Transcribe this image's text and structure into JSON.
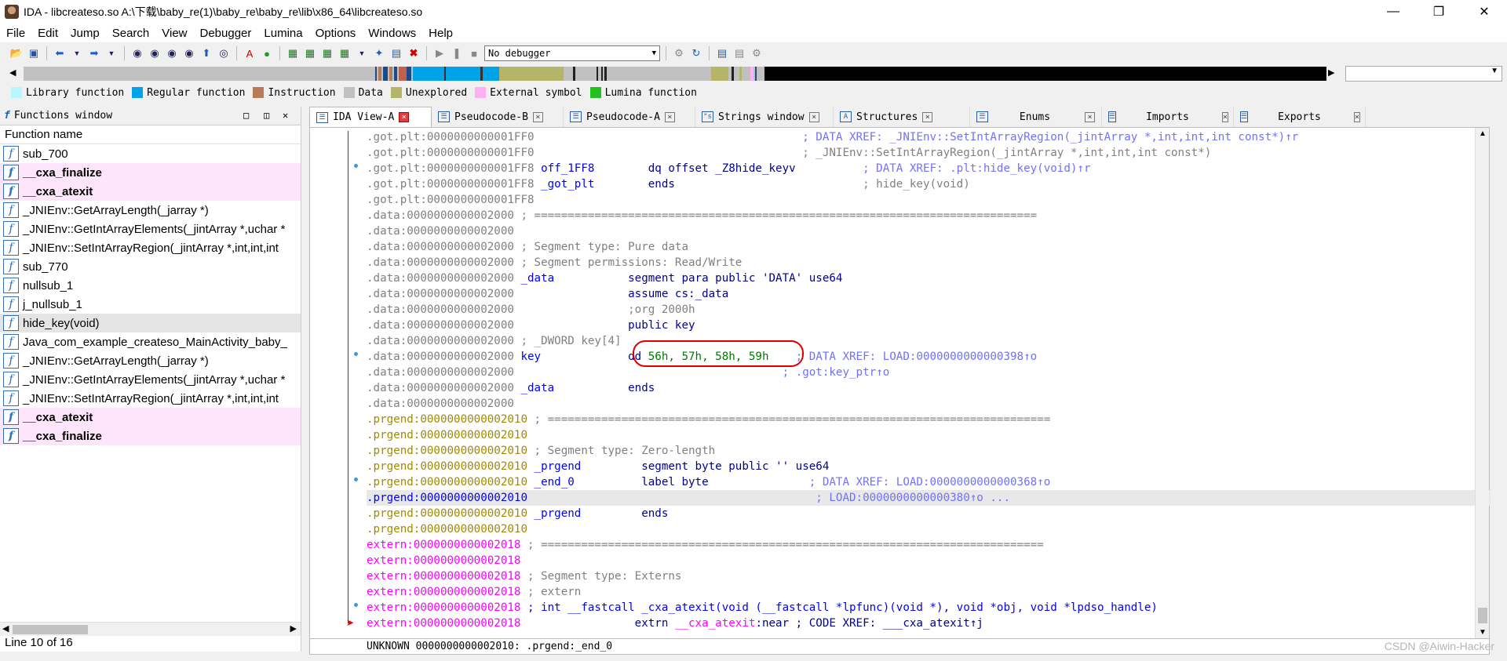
{
  "window": {
    "title": "IDA - libcreateso.so A:\\下载\\baby_re(1)\\baby_re\\baby_re\\lib\\x86_64\\libcreateso.so"
  },
  "menu": [
    "File",
    "Edit",
    "Jump",
    "Search",
    "View",
    "Debugger",
    "Lumina",
    "Options",
    "Windows",
    "Help"
  ],
  "toolbar": {
    "debugger_select": "No debugger"
  },
  "legend": [
    {
      "label": "Library function",
      "color": "#b6f6ff"
    },
    {
      "label": "Regular function",
      "color": "#00a2e8"
    },
    {
      "label": "Instruction",
      "color": "#b97a57"
    },
    {
      "label": "Data",
      "color": "#c0c0c0"
    },
    {
      "label": "Unexplored",
      "color": "#b5b56a"
    },
    {
      "label": "External symbol",
      "color": "#ffb0f0"
    },
    {
      "label": "Lumina function",
      "color": "#22c022"
    }
  ],
  "functions_window": {
    "title": "Functions window",
    "column": "Function name",
    "items": [
      {
        "name": "sub_700",
        "lib": false
      },
      {
        "name": "__cxa_finalize",
        "lib": true
      },
      {
        "name": "__cxa_atexit",
        "lib": true
      },
      {
        "name": "_JNIEnv::GetArrayLength(_jarray *)",
        "lib": false
      },
      {
        "name": "_JNIEnv::GetIntArrayElements(_jintArray *,uchar *",
        "lib": false
      },
      {
        "name": "_JNIEnv::SetIntArrayRegion(_jintArray *,int,int,int",
        "lib": false
      },
      {
        "name": "sub_770",
        "lib": false
      },
      {
        "name": "nullsub_1",
        "lib": false
      },
      {
        "name": "j_nullsub_1",
        "lib": false
      },
      {
        "name": "hide_key(void)",
        "lib": false,
        "selected": true
      },
      {
        "name": "Java_com_example_createso_MainActivity_baby_",
        "lib": false
      },
      {
        "name": "_JNIEnv::GetArrayLength(_jarray *)",
        "lib": false
      },
      {
        "name": "_JNIEnv::GetIntArrayElements(_jintArray *,uchar *",
        "lib": false
      },
      {
        "name": "_JNIEnv::SetIntArrayRegion(_jintArray *,int,int,int",
        "lib": false
      },
      {
        "name": "__cxa_atexit",
        "lib": true
      },
      {
        "name": "__cxa_finalize",
        "lib": true
      }
    ],
    "status": "Line 10 of 16"
  },
  "tabs": [
    {
      "label": "IDA View-A",
      "active": true
    },
    {
      "label": "Pseudocode-B",
      "active": false
    },
    {
      "label": "Pseudocode-A",
      "active": false
    },
    {
      "label": "Strings window",
      "active": false
    },
    {
      "label": "Structures",
      "active": false
    },
    {
      "label": "Enums",
      "active": false
    },
    {
      "label": "Imports",
      "active": false
    },
    {
      "label": "Exports",
      "active": false
    }
  ],
  "disasm": {
    "lines": [
      {
        "seg": "gray",
        "addr": ".got.plt:0000000000001FF0",
        "text": "                                        ",
        "cmt": "; DATA XREF: _JNIEnv::SetIntArrayRegion(_jintArray *,int,int,int const*)↑r"
      },
      {
        "seg": "gray",
        "addr": ".got.plt:0000000000001FF0",
        "text": "                                        ",
        "cmtg": "; _JNIEnv::SetIntArrayRegion(_jintArray *,int,int,int const*)"
      },
      {
        "seg": "gray",
        "addr": ".got.plt:0000000000001FF8",
        "lbl": " off_1FF8",
        "text": "        dq offset _Z8hide_keyv          ",
        "cmt": "; DATA XREF: .plt:hide_key(void)↑r"
      },
      {
        "seg": "gray",
        "addr": ".got.plt:0000000000001FF8",
        "lbl": " _got_plt",
        "text": "        ends                            ",
        "cmtg": "; hide_key(void)"
      },
      {
        "seg": "gray",
        "addr": ".got.plt:0000000000001FF8",
        "text": ""
      },
      {
        "seg": "gray",
        "addr": ".data:0000000000002000",
        "cmtg": " ; ==========================================================================="
      },
      {
        "seg": "gray",
        "addr": ".data:0000000000002000",
        "text": ""
      },
      {
        "seg": "gray",
        "addr": ".data:0000000000002000",
        "cmtg": " ; Segment type: Pure data"
      },
      {
        "seg": "gray",
        "addr": ".data:0000000000002000",
        "cmtg": " ; Segment permissions: Read/Write"
      },
      {
        "seg": "gray",
        "addr": ".data:0000000000002000",
        "lbl": " _data",
        "text": "           segment para public 'DATA' use64"
      },
      {
        "seg": "gray",
        "addr": ".data:0000000000002000",
        "text": "                 assume cs:_data"
      },
      {
        "seg": "gray",
        "addr": ".data:0000000000002000",
        "cmtg": "                 ;org 2000h"
      },
      {
        "seg": "gray",
        "addr": ".data:0000000000002000",
        "text": "                 public key"
      },
      {
        "seg": "gray",
        "addr": ".data:0000000000002000",
        "cmtg": " ; _DWORD key[4]"
      },
      {
        "seg": "gray",
        "addr": ".data:0000000000002000",
        "lbl": " key",
        "text": "             dd ",
        "nums": "56h, 57h, 58h, 59h",
        "cmt": "    ; DATA XREF: LOAD:0000000000000398↑o"
      },
      {
        "seg": "gray",
        "addr": ".data:0000000000002000",
        "text": "                                       ",
        "cmt": " ; .got:key_ptr↑o"
      },
      {
        "seg": "gray",
        "addr": ".data:0000000000002000",
        "lbl": " _data",
        "text": "           ends"
      },
      {
        "seg": "gray",
        "addr": ".data:0000000000002000",
        "text": ""
      },
      {
        "seg": "yellow",
        "addr": ".prgend:0000000000002010",
        "cmtg": " ; ==========================================================================="
      },
      {
        "seg": "yellow",
        "addr": ".prgend:0000000000002010",
        "text": ""
      },
      {
        "seg": "yellow",
        "addr": ".prgend:0000000000002010",
        "cmtg": " ; Segment type: Zero-length"
      },
      {
        "seg": "yellow",
        "addr": ".prgend:0000000000002010",
        "lbl": " _prgend",
        "text": "         segment byte public '' use64"
      },
      {
        "seg": "yellow",
        "addr": ".prgend:0000000000002010",
        "lbl": " _end_0",
        "text": "          label byte               ",
        "cmt": "; DATA XREF: LOAD:0000000000000368↑o"
      },
      {
        "seg": "cur",
        "addr": ".prgend:0000000000002010",
        "text": "                                           ",
        "cmt": "; LOAD:0000000000000380↑o ...",
        "hl": true
      },
      {
        "seg": "yellow",
        "addr": ".prgend:0000000000002010",
        "lbl": " _prgend",
        "text": "         ends"
      },
      {
        "seg": "yellow",
        "addr": ".prgend:0000000000002010",
        "text": ""
      },
      {
        "seg": "pink",
        "addr": "extern:0000000000002018",
        "cmtg": " ; ==========================================================================="
      },
      {
        "seg": "pink",
        "addr": "extern:0000000000002018",
        "text": ""
      },
      {
        "seg": "pink",
        "addr": "extern:0000000000002018",
        "cmtg": " ; Segment type: Externs"
      },
      {
        "seg": "pink",
        "addr": "extern:0000000000002018",
        "cmtg": " ; extern"
      },
      {
        "seg": "pink",
        "addr": "extern:0000000000002018",
        "lbl": " ; int __fastcall _cxa_atexit(void (__fastcall *lpfunc)(void *), void *obj, void *lpdso_handle)"
      },
      {
        "seg": "pink",
        "addr": "extern:0000000000002018",
        "text": "                 extrn ",
        "ext": "__cxa_atexit",
        "text2": ":near ; CODE XREF: ___cxa_atexit↑j"
      }
    ],
    "status": "UNKNOWN 0000000000002010: .prgend:_end_0"
  },
  "watermark": "CSDN @Aiwin-Hacker"
}
